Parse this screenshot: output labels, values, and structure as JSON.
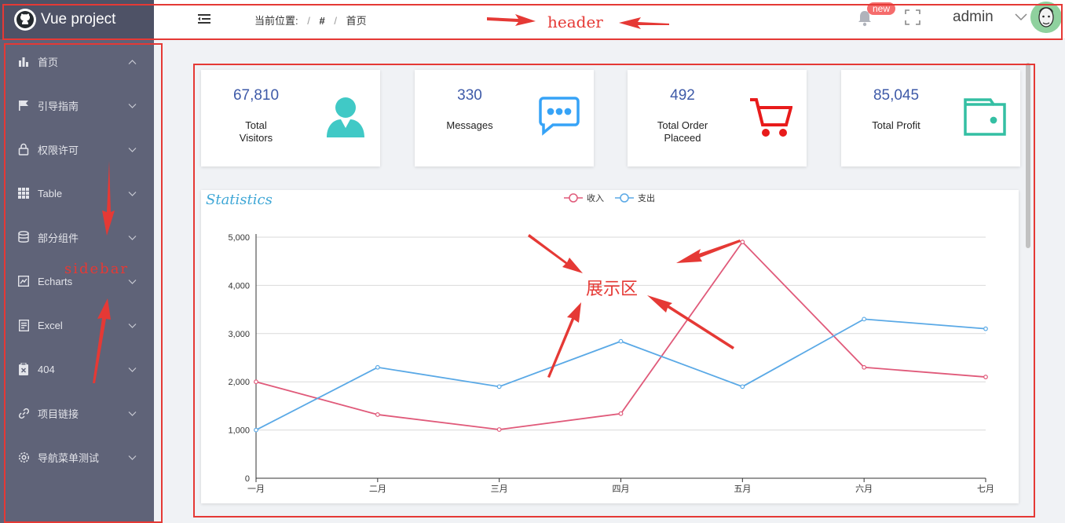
{
  "brand": {
    "title": "Vue project",
    "logo_icon": "github-icon"
  },
  "sidebar": {
    "items": [
      {
        "label": "首页",
        "icon": "bar-chart-icon"
      },
      {
        "label": "引导指南",
        "icon": "flag-icon"
      },
      {
        "label": "权限许可",
        "icon": "lock-icon"
      },
      {
        "label": "Table",
        "icon": "grid-icon"
      },
      {
        "label": "部分组件",
        "icon": "database-icon"
      },
      {
        "label": "Echarts",
        "icon": "line-chart-icon"
      },
      {
        "label": "Excel",
        "icon": "document-icon"
      },
      {
        "label": "404",
        "icon": "clipboard-icon"
      },
      {
        "label": "项目链接",
        "icon": "link-icon"
      },
      {
        "label": "导航菜单测试",
        "icon": "gear-icon"
      }
    ]
  },
  "header": {
    "breadcrumb": [
      "当前位置:",
      "/",
      "#",
      "/",
      "首页"
    ],
    "badge": "new",
    "username": "admin"
  },
  "cards": [
    {
      "value": "67,810",
      "label_lines": [
        "Total",
        "Visitors"
      ],
      "icon": "user-icon",
      "color": "#40c9c6"
    },
    {
      "value": "330",
      "label_lines": [
        "Messages"
      ],
      "icon": "message-icon",
      "color": "#36a3f7"
    },
    {
      "value": "492",
      "label_lines": [
        "Total Order",
        "Placeed"
      ],
      "icon": "cart-icon",
      "color": "#e81b1b"
    },
    {
      "value": "85,045",
      "label_lines": [
        "Total Profit"
      ],
      "icon": "wallet-icon",
      "color": "#34bfa3"
    }
  ],
  "chart_data": {
    "type": "line",
    "title": "Statistics",
    "categories": [
      "一月",
      "二月",
      "三月",
      "四月",
      "五月",
      "六月",
      "七月"
    ],
    "series": [
      {
        "name": "收入",
        "color": "#e05a7a",
        "values": [
          2000,
          1320,
          1010,
          1340,
          4900,
          2300,
          2100
        ]
      },
      {
        "name": "支出",
        "color": "#5aa9e6",
        "values": [
          1000,
          2300,
          1900,
          2840,
          1900,
          3300,
          3100
        ]
      }
    ],
    "yticks": [
      "0",
      "1,000",
      "2,000",
      "3,000",
      "4,000",
      "5,000"
    ],
    "ylim": [
      0,
      5000
    ],
    "legend": "top-center",
    "grid": true
  },
  "annotations": {
    "header": "header",
    "sidebar": "sidebar",
    "display": "展示区"
  }
}
